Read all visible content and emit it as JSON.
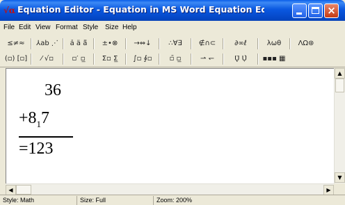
{
  "window": {
    "title": "Equation Editor - Equation in MS Word Equation Editor Quick Gu...",
    "icon_label": "√α",
    "minimize_label": "",
    "maximize_label": "",
    "close_label": "×"
  },
  "menu": [
    "File",
    "Edit",
    "View",
    "Format",
    "Style",
    "Size",
    "Help"
  ],
  "palettes": {
    "row1": [
      {
        "name": "relational",
        "symbols": "≤≠≈"
      },
      {
        "name": "spaces-ellipses",
        "symbols": "⅄ab ⋰"
      },
      {
        "name": "embellishments",
        "symbols": "ả ä ä̈"
      },
      {
        "name": "operators",
        "symbols": "±•⊗"
      },
      {
        "name": "arrows",
        "symbols": "→⇔↓"
      },
      {
        "name": "logical",
        "symbols": "∴∀∃"
      },
      {
        "name": "set-theory",
        "symbols": "∉∩⊂"
      },
      {
        "name": "misc",
        "symbols": "∂∞ℓ"
      },
      {
        "name": "greek-lower",
        "symbols": "λωθ"
      },
      {
        "name": "greek-upper",
        "symbols": "ΛΩ⊛"
      }
    ],
    "row2": [
      {
        "name": "fences",
        "symbols": "(▫) [▫]"
      },
      {
        "name": "fractions-radicals",
        "symbols": "⁄ √▫"
      },
      {
        "name": "sub-superscripts",
        "symbols": "▫′ ▫̲"
      },
      {
        "name": "summations",
        "symbols": "Σ▫ Σ̲"
      },
      {
        "name": "integrals",
        "symbols": "∫▫ ∮▫"
      },
      {
        "name": "underbars-overbars",
        "symbols": "▫̄ ▫̲"
      },
      {
        "name": "labeled-arrows",
        "symbols": "⇀ ↽"
      },
      {
        "name": "products",
        "symbols": "Ų̈ Ụ̇"
      },
      {
        "name": "matrices",
        "symbols": "▪▪▪ ▦"
      }
    ]
  },
  "equation": {
    "line1": "36",
    "line2_prefix": "+8",
    "line2_sub": "1",
    "line2_suffix": "7",
    "line3": "=123"
  },
  "scroll": {
    "up": "▲",
    "down": "▼",
    "left": "◀",
    "right": "▶"
  },
  "status": {
    "style": "Style: Math",
    "size": "Size: Full",
    "zoom": "Zoom: 200%"
  },
  "colors": {
    "titlebar": "#0a5ee8",
    "window_bg": "#ece9d8",
    "close_button": "#c63a14"
  }
}
